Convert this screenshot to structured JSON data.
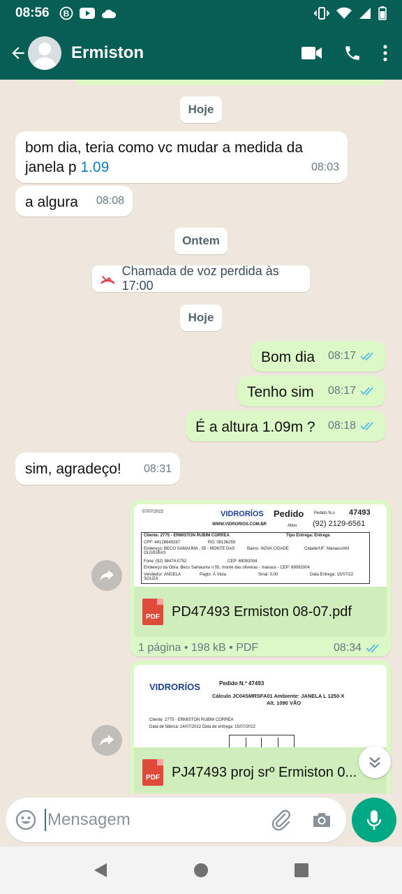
{
  "status_bar": {
    "time": "08:56",
    "icons": [
      "b-icon",
      "youtube-icon",
      "cloud-icon"
    ],
    "right_icons": [
      "vibrate-icon",
      "wifi-icon",
      "signal-icon",
      "battery-icon"
    ]
  },
  "header": {
    "contact_name": "Ermiston",
    "actions": [
      "video-call-icon",
      "phone-icon",
      "more-icon"
    ]
  },
  "chat": {
    "date_today_1": "Hoje",
    "msg1": {
      "text_a": "bom dia, teria como vc mudar a medida da janela p ",
      "link": "1.09",
      "time": "08:03"
    },
    "msg2": {
      "text": "a algura",
      "time": "08:08"
    },
    "date_yesterday": "Ontem",
    "missed_call": "Chamada de voz perdida às 17:00",
    "date_today_2": "Hoje",
    "msg3": {
      "text": "Bom dia",
      "time": "08:17"
    },
    "msg4": {
      "text": "Tenho sim",
      "time": "08:17"
    },
    "msg5": {
      "text": "É a altura 1.09m ?",
      "time": "08:18"
    },
    "msg6": {
      "text": "sim, agradeço!",
      "time": "08:31"
    },
    "doc1": {
      "filename": "PD47493 Ermiston 08-07.pdf",
      "pages": "1 página",
      "size": "198 kB",
      "type": "PDF",
      "time": "08:34",
      "preview": {
        "date": "07/07/2022",
        "brand": "VIDRORÍOS",
        "title": "Pedido",
        "order_label": "Pedido N.o",
        "order_no": "47493",
        "site": "WWW.VIDRORIOS.COM.BR",
        "status": "Ativo",
        "phone": "(92) 2129-6561",
        "client": "Cliente:  2775 - ERMISTON RUBIM CORREA",
        "delivery": "Tipo Entrega:  Entrega",
        "cpf": "CPF: 44128649287",
        "rg": "RG: 09136258",
        "address": "Endereço: BECO SAMAÚMA , 55 - MONTE DAS OLIVEIRAS",
        "district": "Bairro: NOVA CIDADE",
        "city": "Cidade/UF: Manaus/AM",
        "fone": "Fone:  (92) 98474-0752",
        "cep": "CEP:  69092004",
        "work_address": "Endereço da Obra: Beco Samauma n 55, monte das oliveiras - manaus - CEP: 69092004",
        "seller": "Vendedor:  ANGELA SOUZA",
        "payment": "Pagto:  À Vista",
        "sinal": "Sinal:  0,00",
        "delivery_date": "Data Entrega:  15/07/22"
      }
    },
    "doc2": {
      "filename": "PJ47493 proj srº Ermiston 0...",
      "preview": {
        "brand": "VIDRORÍOS",
        "order": "Pedido N.º 47493",
        "calc": "Cálculo JC04SMRSFA01 Ambiente: JANELA L 1250 X",
        "calc2": "Alt. 1090 VÃO",
        "client": "Cliente:    2775 - ERMISTON RUBIM CORREA",
        "dates": "Data de fábrica: 14/07/2022    Data de entrega: 15/07/2022"
      }
    }
  },
  "composer": {
    "placeholder": "Mensagem"
  },
  "colors": {
    "header": "#075e54",
    "outgoing": "#dcf8c6",
    "incoming": "#ffffff",
    "accent": "#00a884",
    "ticks": "#53bdeb"
  }
}
